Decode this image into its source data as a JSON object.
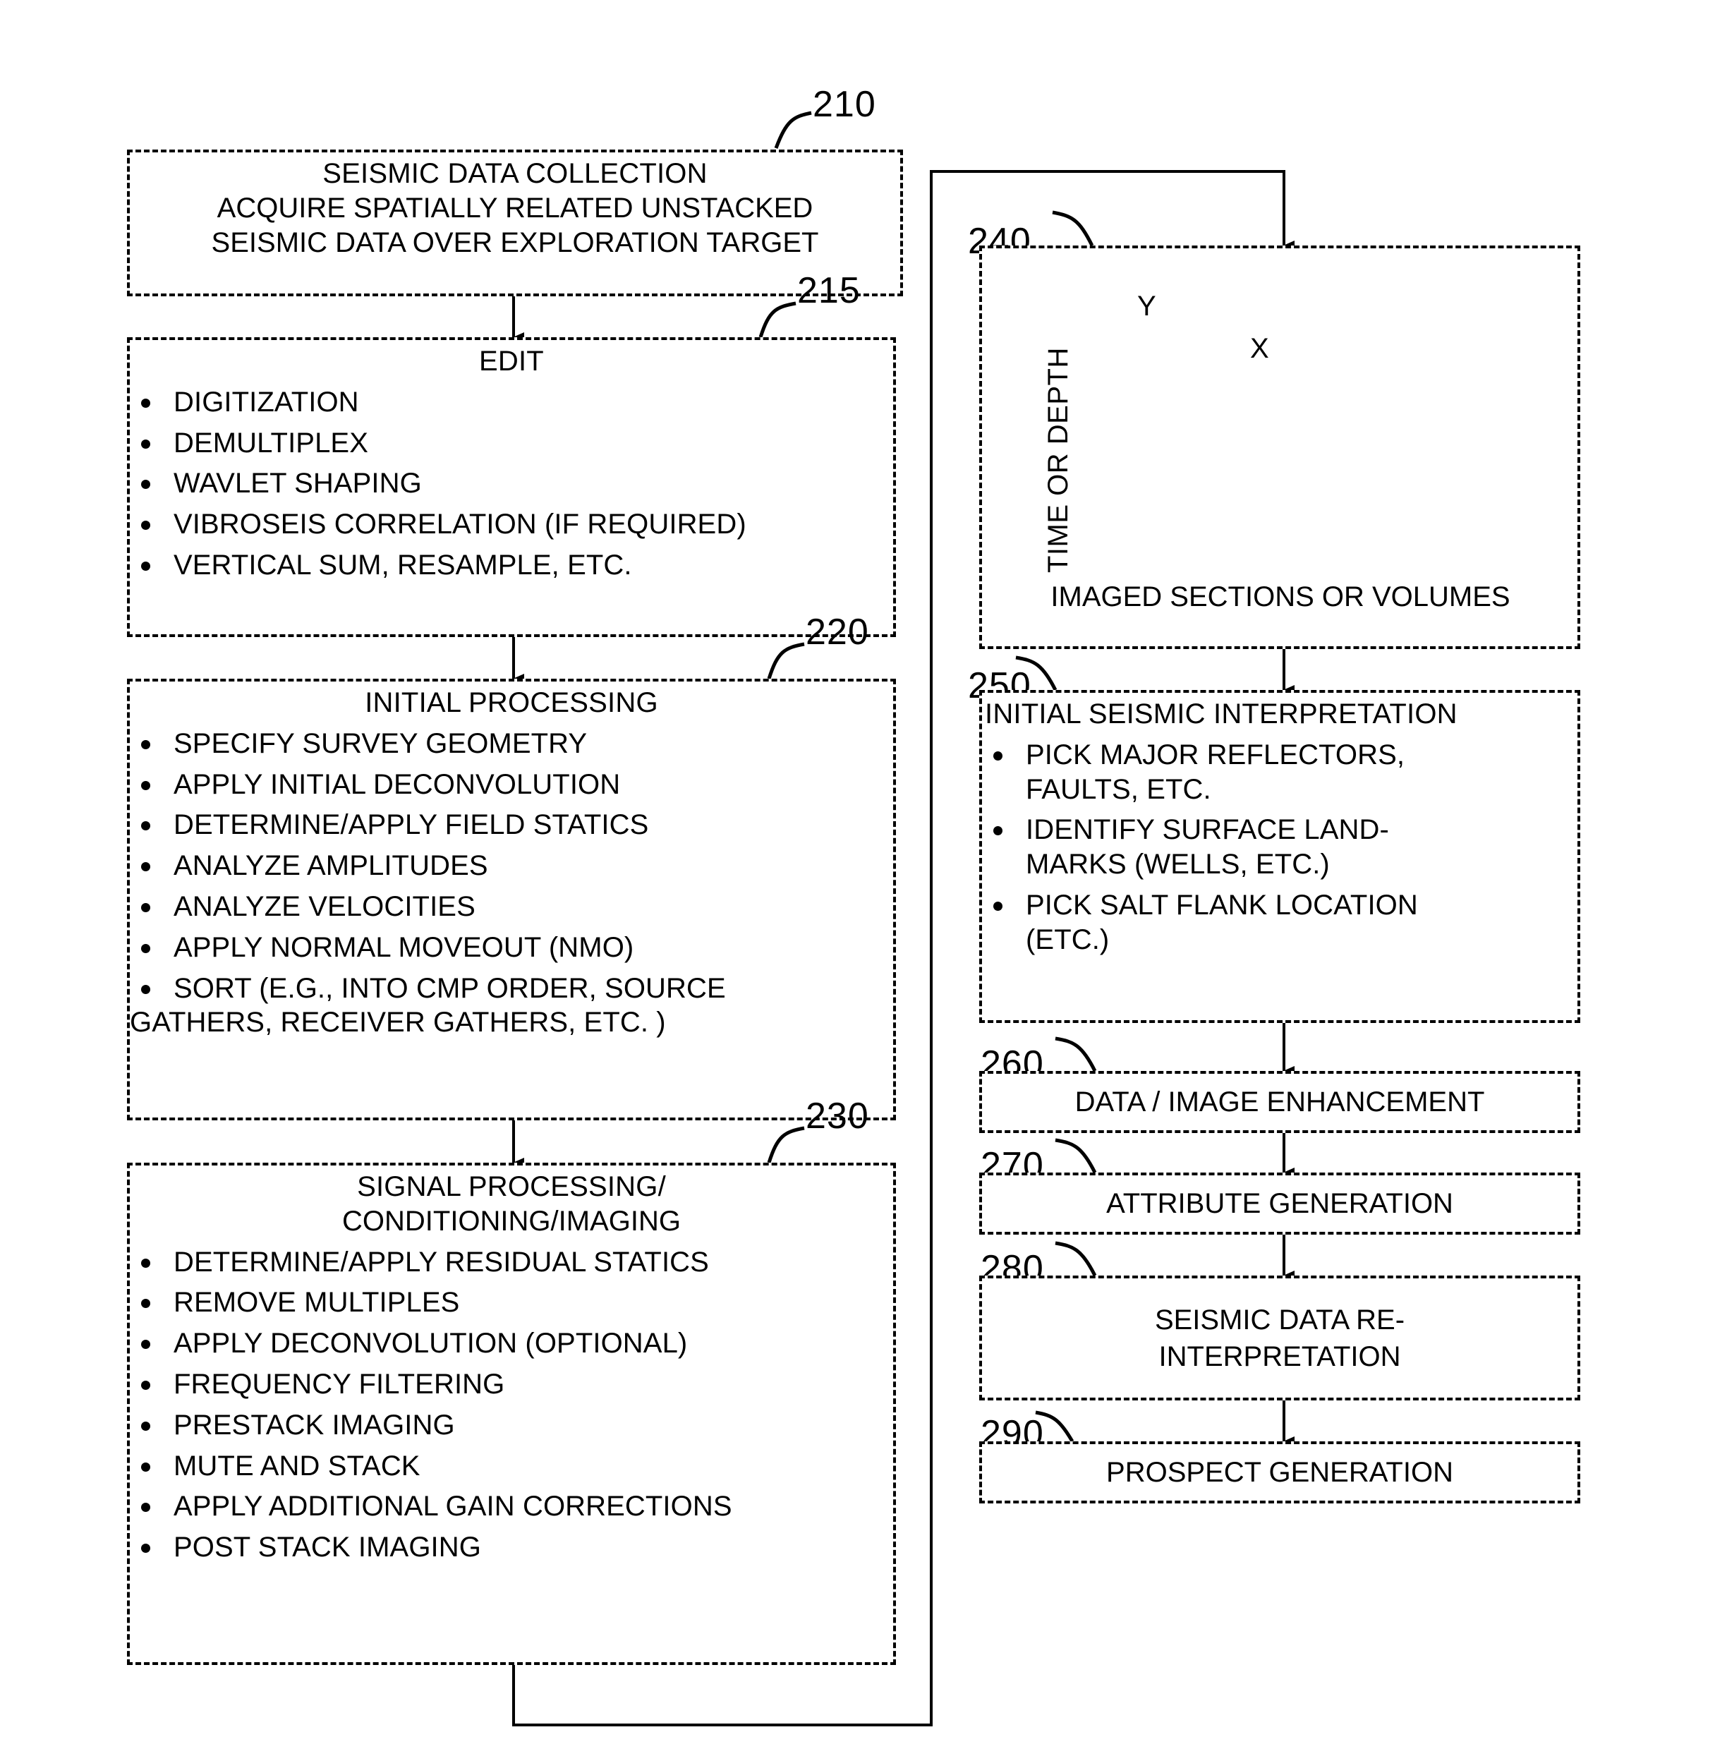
{
  "figure": {
    "type": "patent-flowchart",
    "line_style": "dashed-black-on-white"
  },
  "blocks": {
    "b210": {
      "ref": "210",
      "title": "SEISMIC DATA COLLECTION",
      "lines": [
        "ACQUIRE SPATIALLY RELATED UNSTACKED",
        "SEISMIC DATA OVER EXPLORATION TARGET"
      ]
    },
    "b215": {
      "ref": "215",
      "title": "EDIT",
      "items": [
        "DIGITIZATION",
        "DEMULTIPLEX",
        "WAVLET SHAPING",
        "VIBROSEIS CORRELATION (IF REQUIRED)",
        "VERTICAL SUM, RESAMPLE, ETC."
      ]
    },
    "b220": {
      "ref": "220",
      "title": "INITIAL PROCESSING",
      "items": [
        "SPECIFY SURVEY GEOMETRY",
        "APPLY INITIAL DECONVOLUTION",
        "DETERMINE/APPLY FIELD STATICS",
        "ANALYZE AMPLITUDES",
        "ANALYZE VELOCITIES",
        "APPLY NORMAL MOVEOUT (NMO)",
        "SORT (E.G., INTO CMP ORDER, SOURCE"
      ],
      "continuation": "GATHERS, RECEIVER GATHERS, ETC. )"
    },
    "b230": {
      "ref": "230",
      "title_line1": "SIGNAL PROCESSING/",
      "title_line2": "CONDITIONING/IMAGING",
      "items": [
        "DETERMINE/APPLY RESIDUAL STATICS",
        "REMOVE MULTIPLES",
        "APPLY DECONVOLUTION (OPTIONAL)",
        "FREQUENCY FILTERING",
        "PRESTACK IMAGING",
        "MUTE AND STACK",
        "APPLY ADDITIONAL GAIN CORRECTIONS",
        "POST STACK IMAGING"
      ]
    },
    "b240": {
      "ref": "240",
      "axis_vertical": "TIME OR DEPTH",
      "axis_y": "Y",
      "axis_x": "X",
      "caption": "IMAGED SECTIONS OR VOLUMES"
    },
    "b250": {
      "ref": "250",
      "title": "INITIAL SEISMIC INTERPRETATION",
      "items": [
        "PICK MAJOR REFLECTORS, FAULTS, ETC.",
        "IDENTIFY SURFACE LAND-MARKS (WELLS, ETC.)",
        "PICK SALT FLANK LOCATION (ETC.)"
      ],
      "items_wrapped": [
        [
          "PICK MAJOR REFLECTORS,",
          "FAULTS, ETC."
        ],
        [
          "IDENTIFY SURFACE LAND-",
          "MARKS (WELLS, ETC.)"
        ],
        [
          "PICK SALT FLANK LOCATION",
          "(ETC.)"
        ]
      ]
    },
    "b260": {
      "ref": "260",
      "title": "DATA / IMAGE ENHANCEMENT"
    },
    "b270": {
      "ref": "270",
      "title": "ATTRIBUTE GENERATION"
    },
    "b280": {
      "ref": "280",
      "title_line1": "SEISMIC DATA RE-",
      "title_line2": "INTERPRETATION"
    },
    "b290": {
      "ref": "290",
      "title": "PROSPECT GENERATION"
    }
  }
}
